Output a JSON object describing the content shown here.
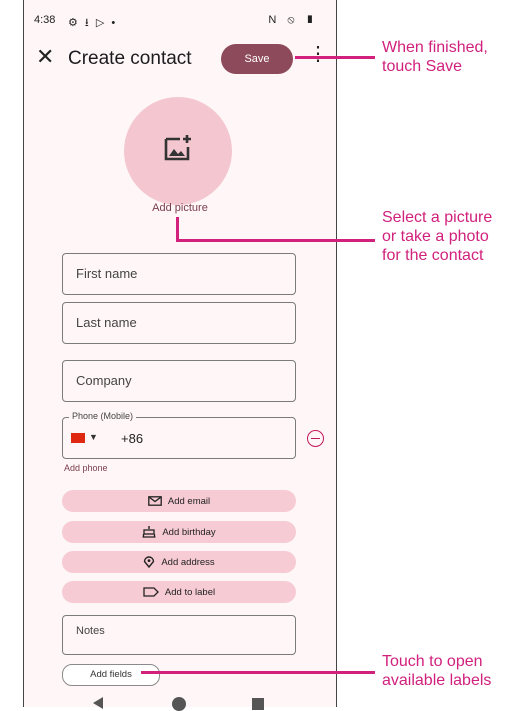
{
  "status_bar": {
    "time": "4:38",
    "left_icons": "⚙ ⭳ ▷ •",
    "right_icons": "N ⦸ ▮"
  },
  "app_bar": {
    "close_icon": "close-icon",
    "title": "Create contact",
    "save_label": "Save",
    "more_icon": "more-vert-icon"
  },
  "avatar": {
    "icon": "add-photo-icon",
    "label": "Add picture"
  },
  "fields": {
    "first_name": "First name",
    "last_name": "Last name",
    "company": "Company",
    "phone_label": "Phone (Mobile)",
    "phone_value": "+86",
    "phone_flag": "CN"
  },
  "add_phone": "Add phone",
  "pills": {
    "email": "Add email",
    "birthday": "Add birthday",
    "address": "Add address",
    "label": "Add to label"
  },
  "notes": "Notes",
  "add_fields": "Add fields",
  "callouts": {
    "save": [
      "When finished,",
      "touch Save"
    ],
    "picture": [
      "Select a picture",
      "or take a photo",
      "for the contact"
    ],
    "fields": [
      "Touch to open",
      "available labels"
    ]
  },
  "colors": {
    "accent": "#8d4a5a",
    "pill": "#f6cbd4",
    "avatar": "#f4c7d0",
    "callout": "#d1217d"
  }
}
